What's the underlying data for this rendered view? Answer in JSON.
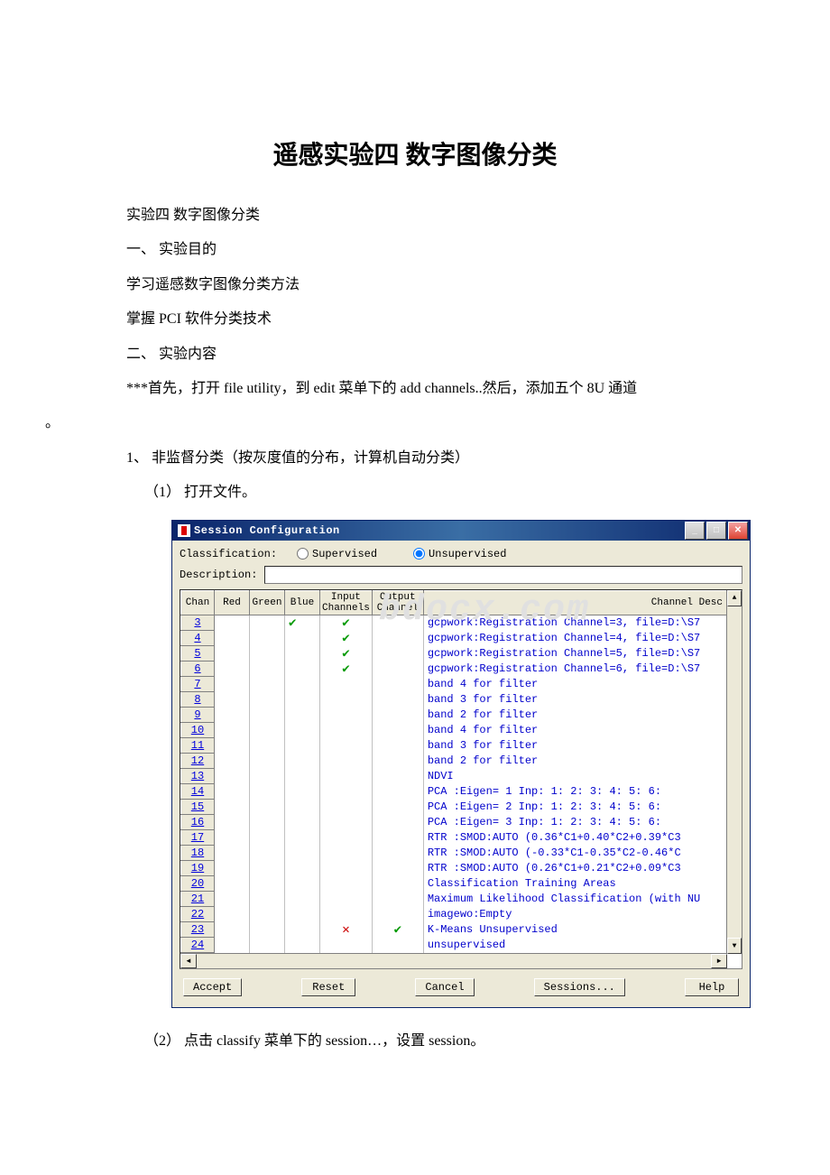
{
  "doc": {
    "title": "遥感实验四 数字图像分类",
    "p1": "实验四 数字图像分类",
    "p2": "一、 实验目的",
    "p3": "学习遥感数字图像分类方法",
    "p4": "掌握 PCI 软件分类技术",
    "p5": "二、 实验内容",
    "p6": " ***首先，打开 file utility，到 edit 菜单下的 add channels..然后，添加五个 8U 通道",
    "p6b": "。",
    "p7": "1、 非监督分类（按灰度值的分布，计算机自动分类）",
    "p8": "（1） 打开文件。",
    "p9": "（2） 点击 classify 菜单下的 session…，设置 session。"
  },
  "win": {
    "title": "Session Configuration",
    "classification_label": "Classification:",
    "supervised": "Supervised",
    "unsupervised": "Unsupervised",
    "description_label": "Description:",
    "headers": {
      "chan": "Chan",
      "red": "Red",
      "green": "Green",
      "blue": "Blue",
      "input": "Input Channels",
      "output": "Output Channel",
      "desc": "Channel Desc"
    },
    "rows": [
      {
        "n": "3",
        "blue": "✔",
        "in": "✔",
        "desc": "gcpwork:Registration Channel=3, file=D:\\S7"
      },
      {
        "n": "4",
        "in": "✔",
        "desc": "gcpwork:Registration Channel=4, file=D:\\S7"
      },
      {
        "n": "5",
        "in": "✔",
        "desc": "gcpwork:Registration Channel=5, file=D:\\S7"
      },
      {
        "n": "6",
        "in": "✔",
        "desc": "gcpwork:Registration Channel=6, file=D:\\S7"
      },
      {
        "n": "7",
        "desc": "band 4 for filter"
      },
      {
        "n": "8",
        "desc": "band 3 for filter"
      },
      {
        "n": "9",
        "desc": "band 2 for filter"
      },
      {
        "n": "10",
        "desc": "band 4 for filter"
      },
      {
        "n": "11",
        "desc": "band 3 for filter"
      },
      {
        "n": "12",
        "desc": "band 2 for filter"
      },
      {
        "n": "13",
        "desc": "NDVI"
      },
      {
        "n": "14",
        "desc": "PCA    :Eigen= 1  Inp: 1: 2: 3: 4: 5: 6:"
      },
      {
        "n": "15",
        "desc": "PCA    :Eigen= 2  Inp: 1: 2: 3: 4: 5: 6:"
      },
      {
        "n": "16",
        "desc": "PCA    :Eigen= 3  Inp: 1: 2: 3: 4: 5: 6:"
      },
      {
        "n": "17",
        "desc": "RTR    :SMOD:AUTO (0.36*C1+0.40*C2+0.39*C3"
      },
      {
        "n": "18",
        "desc": "RTR    :SMOD:AUTO (-0.33*C1-0.35*C2-0.46*C"
      },
      {
        "n": "19",
        "desc": "RTR    :SMOD:AUTO (0.26*C1+0.21*C2+0.09*C3"
      },
      {
        "n": "20",
        "desc": "Classification Training Areas"
      },
      {
        "n": "21",
        "desc": "Maximum Likelihood Classification (with NU"
      },
      {
        "n": "22",
        "desc": "imagewo:Empty"
      },
      {
        "n": "23",
        "in": "✕",
        "out": "✔",
        "desc": "K-Means Unsupervised"
      },
      {
        "n": "24",
        "desc": "unsupervised"
      }
    ],
    "buttons": {
      "accept": "Accept",
      "reset": "Reset",
      "cancel": "Cancel",
      "sessions": "Sessions...",
      "help": "Help"
    }
  }
}
